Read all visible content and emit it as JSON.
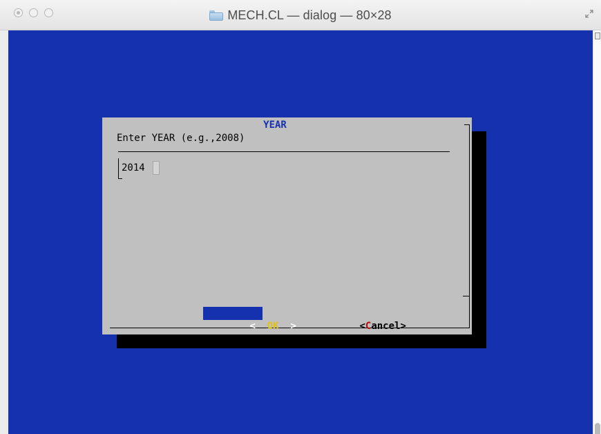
{
  "window": {
    "title": "MECH.CL — dialog — 80×28",
    "folder_icon": "folder-icon",
    "fullscreen_icon": "fullscreen-icon"
  },
  "colors": {
    "terminal_background": "#1631ad",
    "dialog_background": "#c0c0c0",
    "dialog_title": "#1631ad",
    "ok_button_background": "#1631ad",
    "ok_hotkey": "#e0c21a",
    "cancel_hotkey": "#b10b0b"
  },
  "dialog": {
    "title": "YEAR",
    "prompt": "Enter YEAR (e.g.,2008)",
    "input_value": "2014",
    "ok_button": {
      "left_bracket": "<",
      "hotkey": "OK",
      "right_bracket": ">"
    },
    "cancel_button": {
      "open": "<",
      "hotkey": "C",
      "rest": "ancel",
      "close": ">"
    }
  }
}
